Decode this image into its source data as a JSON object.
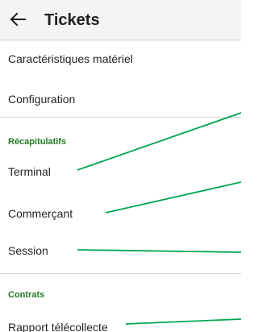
{
  "app_bar": {
    "back_icon": "arrow-left-icon",
    "title": "Tickets"
  },
  "items": {
    "hardware": "Caractéristiques matériel",
    "configuration": "Configuration"
  },
  "recaps": {
    "header": "Récapitulatifs",
    "terminal": "Terminal",
    "merchant": "Commerçant",
    "session": "Session"
  },
  "contracts": {
    "header": "Contrats",
    "report": "Rapport télécollecte"
  },
  "colors": {
    "section_header": "#237a24",
    "annotation_lines": "#00a650",
    "app_bar": "#f4f4f4"
  }
}
